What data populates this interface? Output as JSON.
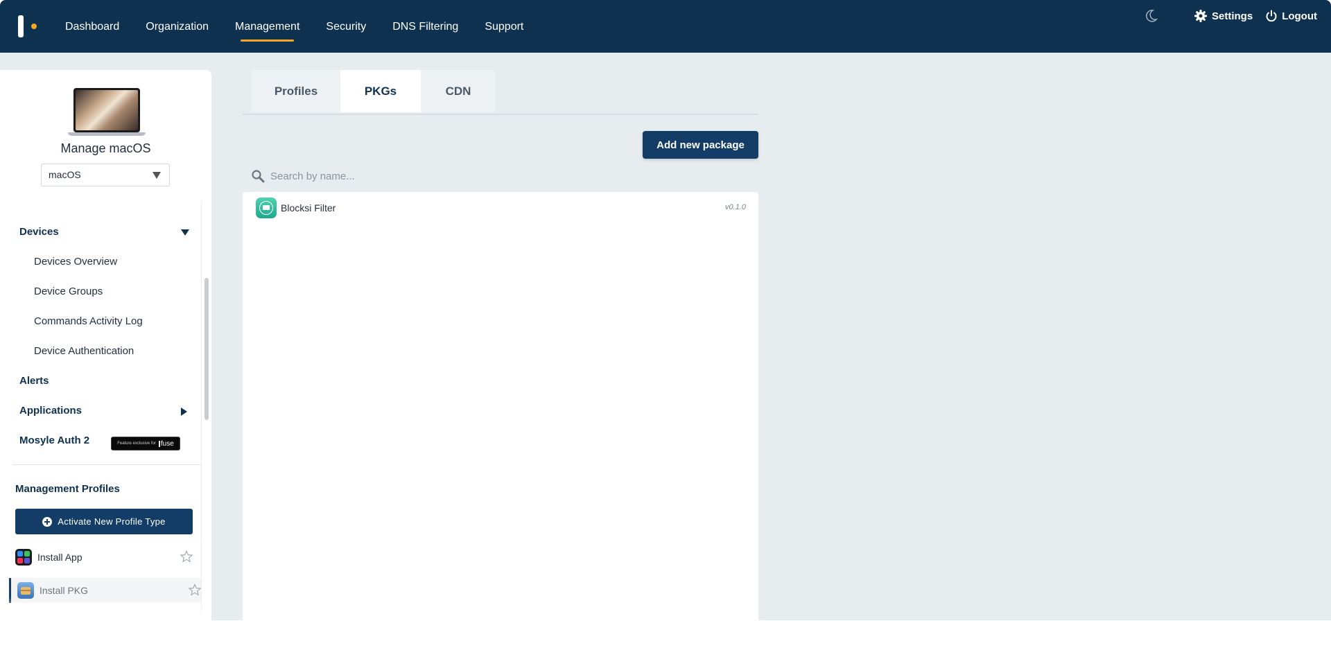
{
  "topnav": {
    "items": [
      {
        "label": "Dashboard",
        "active": false
      },
      {
        "label": "Organization",
        "active": false
      },
      {
        "label": "Management",
        "active": true
      },
      {
        "label": "Security",
        "active": false
      },
      {
        "label": "DNS Filtering",
        "active": false
      },
      {
        "label": "Support",
        "active": false
      }
    ],
    "settings_label": "Settings",
    "logout_label": "Logout"
  },
  "sidebar": {
    "title": "Manage macOS",
    "os_select": {
      "value": "macOS"
    },
    "menu": {
      "devices": "Devices",
      "devices_overview": "Devices Overview",
      "device_groups": "Device Groups",
      "commands_activity_log": "Commands Activity Log",
      "device_authentication": "Device Authentication",
      "alerts": "Alerts",
      "applications": "Applications",
      "mosyle_auth": "Mosyle Auth 2",
      "badge_text": "Feature exclusive for",
      "badge_brand": "fuse"
    },
    "management_profiles": {
      "title": "Management Profiles",
      "activate_label": "Activate New Profile Type",
      "items": [
        {
          "label": "Install App",
          "selected": false
        },
        {
          "label": "Install PKG",
          "selected": true
        }
      ]
    }
  },
  "main": {
    "tabs": [
      {
        "label": "Profiles",
        "active": false
      },
      {
        "label": "PKGs",
        "active": true
      },
      {
        "label": "CDN",
        "active": false
      }
    ],
    "add_button_label": "Add new package",
    "search": {
      "placeholder": "Search by name...",
      "value": ""
    },
    "packages": [
      {
        "name": "Blocksi Filter",
        "version": "v0.1.0"
      }
    ]
  },
  "colors": {
    "navy": "#0e3150",
    "accent": "#f5a623",
    "button": "#133d66",
    "background": "#e7ecef"
  }
}
